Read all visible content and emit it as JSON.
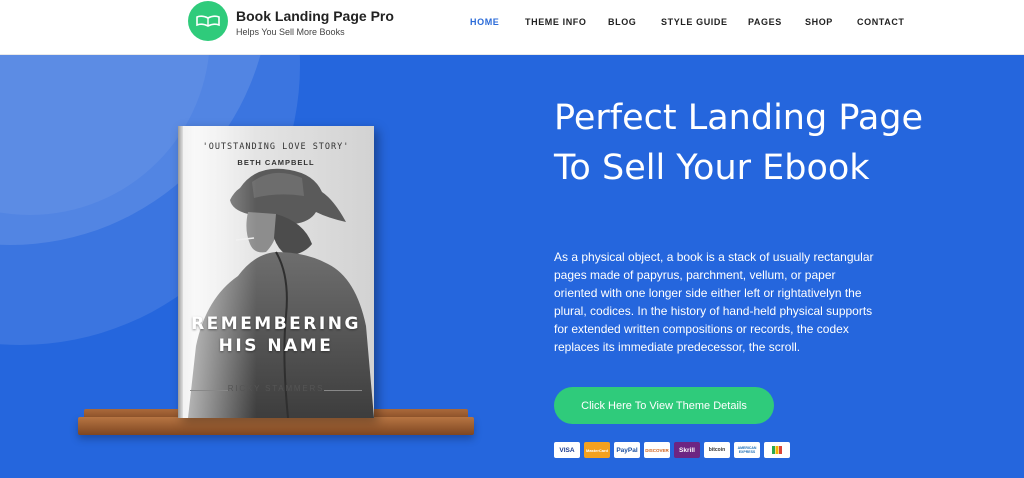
{
  "header": {
    "site_title": "Book Landing Page Pro",
    "site_tagline": "Helps You Sell More Books",
    "logo_icon": "open-book-icon",
    "nav": [
      {
        "label": "HOME",
        "active": true
      },
      {
        "label": "THEME INFO",
        "active": false
      },
      {
        "label": "BLOG",
        "active": false
      },
      {
        "label": "STYLE GUIDE",
        "active": false
      },
      {
        "label": "PAGES",
        "active": false
      },
      {
        "label": "SHOP",
        "active": false
      },
      {
        "label": "CONTACT",
        "active": false
      }
    ]
  },
  "book": {
    "quote": "'OUTSTANDING LOVE STORY'",
    "author": "BETH CAMPBELL",
    "title_line1": "REMEMBERING",
    "title_line2": "HIS NAME",
    "publisher": "RICKY STAMMERS"
  },
  "hero": {
    "title": "Perfect Landing Page To Sell Your Ebook",
    "description": "As a physical object, a book is a stack of usually rectangular pages made of papyrus, parchment, vellum, or paper oriented with one longer side either left or rightativelyn the plural, codices. In the history of hand-held physical supports for extended written compositions or records, the codex replaces its immediate predecessor, the scroll.",
    "cta_label": "Click Here To View Theme Details"
  },
  "payments": [
    "VISA",
    "MasterCard",
    "PayPal",
    "DISCOVER",
    "Skrill",
    "bitcoin",
    "AMERICAN EXPRESS",
    "Google Wallet"
  ],
  "colors": {
    "hero_bg": "#2566dd",
    "accent_green": "#2fcb7b",
    "nav_active": "#2b6bd8"
  }
}
